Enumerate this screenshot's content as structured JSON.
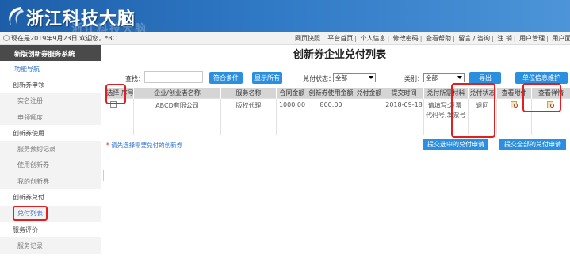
{
  "banner": {
    "site_name": "浙江科技大脑"
  },
  "topbar": {
    "welcome": "现在是2019年9月23日 欢迎您，*BC",
    "links": [
      "网页快照",
      "平台首页",
      "个人信息",
      "修改密码",
      "查看帮助",
      "留言 / 咨询",
      "注 销",
      "用户管理",
      "用户面板"
    ]
  },
  "sidebar": {
    "header": "新版创新券服务系统",
    "items": [
      {
        "label": "功能导航",
        "type": "nav"
      },
      {
        "label": "创新券申领",
        "type": "cat"
      },
      {
        "label": "实名注册",
        "type": "sub"
      },
      {
        "label": "申领额度",
        "type": "sub"
      },
      {
        "label": "创新券使用",
        "type": "cat"
      },
      {
        "label": "服务预约记录",
        "type": "sub"
      },
      {
        "label": "使用创新券",
        "type": "sub"
      },
      {
        "label": "我的创新券",
        "type": "sub"
      },
      {
        "label": "创新券兑付",
        "type": "cat"
      },
      {
        "label": "兑付列表",
        "type": "active"
      },
      {
        "label": "服务评价",
        "type": "cat"
      },
      {
        "label": "服务记录",
        "type": "sub"
      }
    ]
  },
  "main": {
    "title": "创新券企业兑付列表",
    "search_label": "查找：",
    "search_value": "",
    "btn_match": "符合条件",
    "btn_show_all": "显示所有",
    "status_label": "兑付状态：",
    "status_value": "全部",
    "category_label": "类别：",
    "category_value": "全部",
    "btn_export": "导出",
    "btn_unit_info": "单位信息维护",
    "hint_star": "*",
    "hint": " 请先选择需要兑付的创新券",
    "btn_submit_selected": "提交选中的兑付申请",
    "btn_submit_all": "提交全部的兑付申请"
  },
  "table": {
    "columns": [
      "选择",
      "序号",
      "企业/创业者名称",
      "服务名称",
      "合同金额",
      "创新券使用金额",
      "兑付金额",
      "提交时间",
      "兑付所需材料",
      "兑付状态",
      "查看附件",
      "查看详情"
    ],
    "rows": [
      {
        "index": "",
        "company": "ABCD有限公司",
        "service": "版权代理",
        "contract_amount": "1000.00",
        "voucher_amount": "800.00",
        "payout_amount": "",
        "submit_time": "2018-09-18",
        "materials": ";请填写:发票代码号,发票号",
        "status": "退回"
      }
    ]
  }
}
